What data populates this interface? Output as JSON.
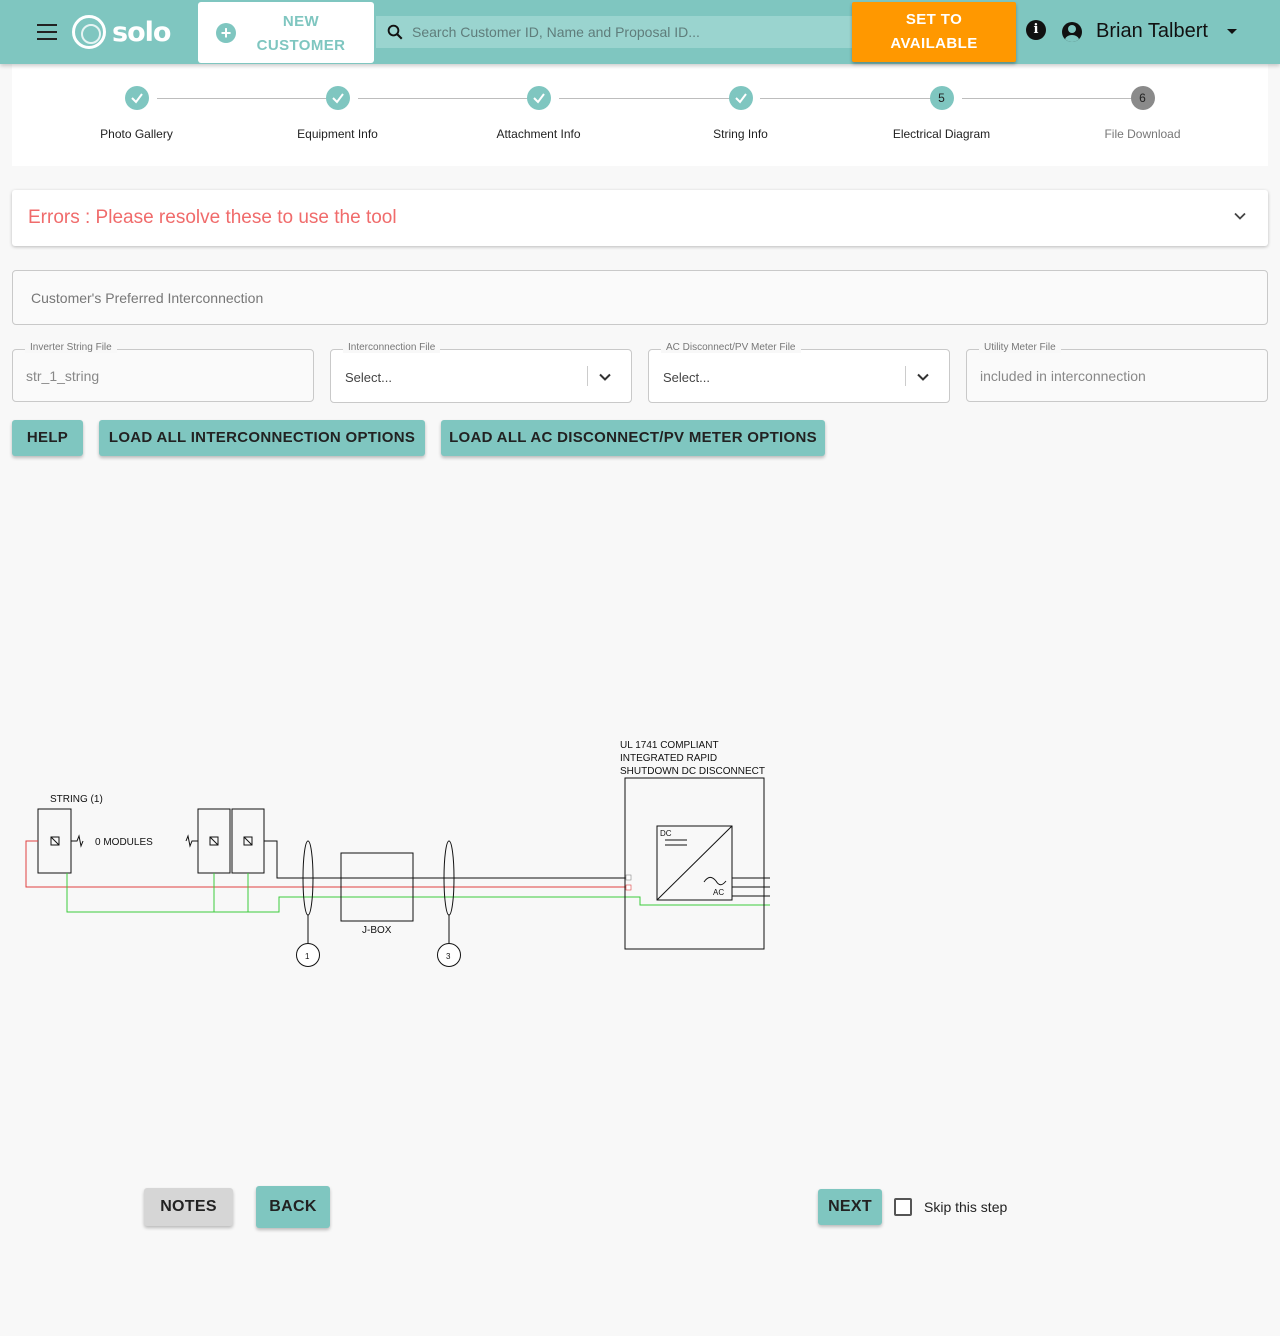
{
  "header": {
    "logo_text": "solo",
    "new_customer_line1": "NEW",
    "new_customer_line2": "CUSTOMER",
    "search_placeholder": "Search Customer ID, Name and Proposal ID...",
    "available_line1": "SET TO",
    "available_line2": "AVAILABLE",
    "info_glyph": "i",
    "user_name": "Brian Talbert",
    "colors": {
      "header_bg": "#7fc6c0",
      "available_bg": "#ff9800"
    }
  },
  "stepper": {
    "steps": [
      {
        "label": "Photo Gallery",
        "state": "complete",
        "number": "1"
      },
      {
        "label": "Equipment Info",
        "state": "complete",
        "number": "2"
      },
      {
        "label": "Attachment Info",
        "state": "complete",
        "number": "3"
      },
      {
        "label": "String Info",
        "state": "complete",
        "number": "4"
      },
      {
        "label": "Electrical Diagram",
        "state": "active",
        "number": "5"
      },
      {
        "label": "File Download",
        "state": "pending",
        "number": "6"
      }
    ]
  },
  "errors": {
    "title": "Errors : Please resolve these to use the tool",
    "color": "#f06b6b"
  },
  "form": {
    "preferred_interconnection_placeholder": "Customer's Preferred Interconnection",
    "inverter_string_file": {
      "label": "Inverter String File",
      "value": "str_1_string"
    },
    "interconnection_file": {
      "label": "Interconnection File",
      "value": "Select..."
    },
    "ac_disconnect_file": {
      "label": "AC Disconnect/PV Meter File",
      "value": "Select..."
    },
    "utility_meter_file": {
      "label": "Utility Meter File",
      "value": "included in interconnection"
    }
  },
  "actions": {
    "help": "HELP",
    "load_interconnection": "LOAD ALL INTERCONNECTION OPTIONS",
    "load_ac_disconnect": "LOAD ALL AC DISCONNECT/PV METER OPTIONS"
  },
  "diagram": {
    "string_label": "STRING (1)",
    "modules_label": "0 MODULES",
    "jbox_label": "J-BOX",
    "marker_1": "1",
    "marker_3": "3",
    "inverter_title_line1": "UL 1741 COMPLIANT",
    "inverter_title_line2": "INTEGRATED RAPID",
    "inverter_title_line3": "SHUTDOWN DC DISCONNECT",
    "dc_label": "DC",
    "ac_label": "AC",
    "colors": {
      "positive": "#e04040",
      "ground": "#3ccc3c",
      "wire": "#111111"
    }
  },
  "footer": {
    "notes": "NOTES",
    "back": "BACK",
    "next": "NEXT",
    "skip_label": "Skip this step",
    "skip_checked": false
  }
}
